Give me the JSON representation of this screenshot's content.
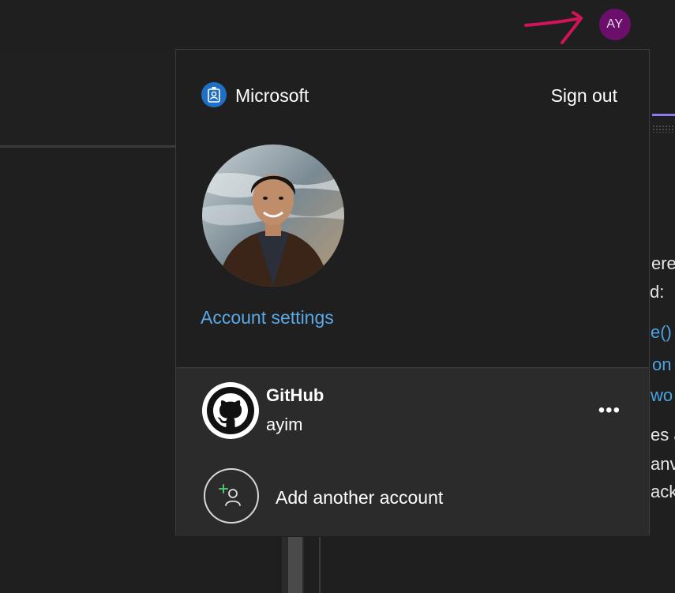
{
  "header": {
    "avatar_initials": "AY"
  },
  "flyout": {
    "provider": {
      "label": "Microsoft",
      "icon": "microsoft-account-icon"
    },
    "sign_out_label": "Sign out",
    "account_settings_label": "Account settings",
    "accounts": [
      {
        "service": "GitHub",
        "username": "ayim",
        "icon": "github-icon"
      }
    ],
    "more_label": "•••",
    "add_account_label": "Add another account"
  },
  "background_text": [
    "ere",
    "d:",
    "e()",
    "on",
    "wo",
    "es a",
    "anv",
    "ack"
  ],
  "colors": {
    "avatar_bg": "#6b0f6b",
    "link": "#5aa9e6",
    "annotation": "#d1145a",
    "ms_icon_bg": "#1f6fc4"
  }
}
